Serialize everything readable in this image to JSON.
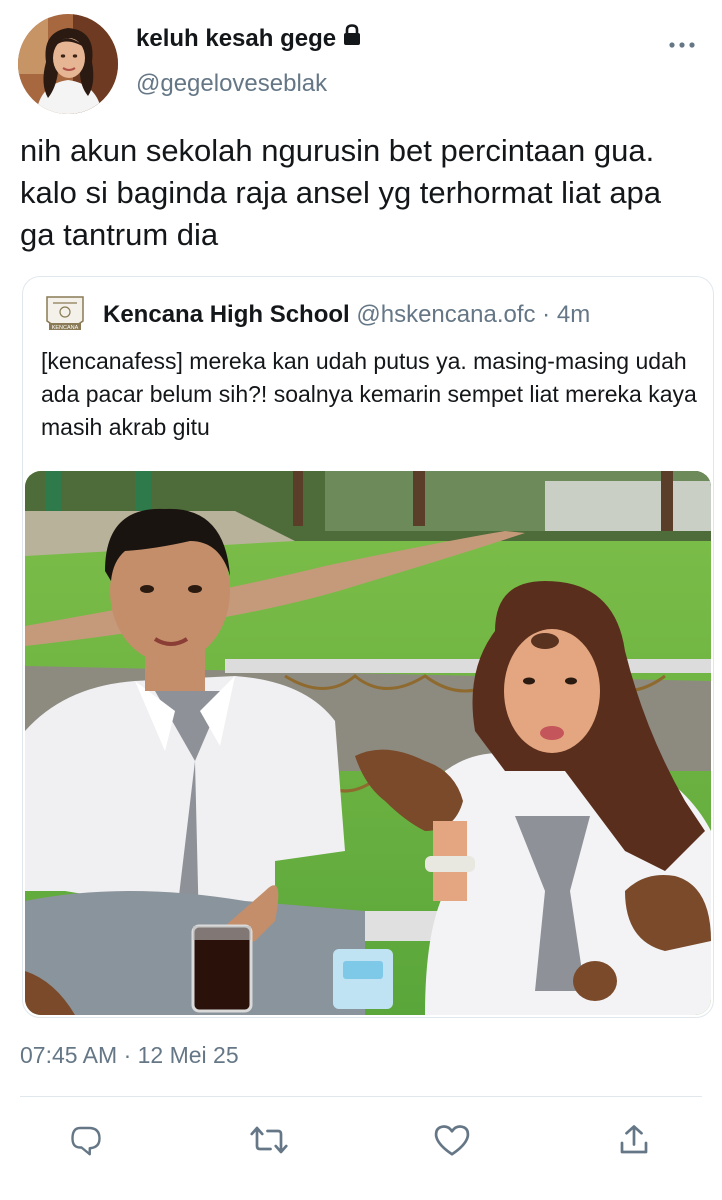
{
  "tweet": {
    "display_name": "keluh kesah gege",
    "handle": "@gegeloveseblak",
    "text": "nih akun sekolah ngurusin bet percintaan gua. kalo si baginda raja ansel yg terhormat liat apa ga tantrum dia",
    "timestamp": "07:45 AM · 12 Mei 25",
    "locked": true
  },
  "quoted": {
    "name": "Kencana High School",
    "handle": "@hskencana.ofc",
    "separator": " · ",
    "time": "4m",
    "text": "[kencanafess] mereka kan udah putus ya. masing-masing udah ada pacar belum sih?! soalnya kemarin sempet liat mereka kaya masih akrab gitu",
    "logo_text": "KENCANA"
  },
  "icons": {
    "lock": "lock-icon",
    "more": "more-horizontal-icon",
    "reply": "reply-icon",
    "retweet": "retweet-icon",
    "like": "heart-icon",
    "share": "share-icon"
  },
  "colors": {
    "text": "#14171a",
    "muted": "#657786",
    "border": "#e1e8ed",
    "icon": "#657786"
  }
}
